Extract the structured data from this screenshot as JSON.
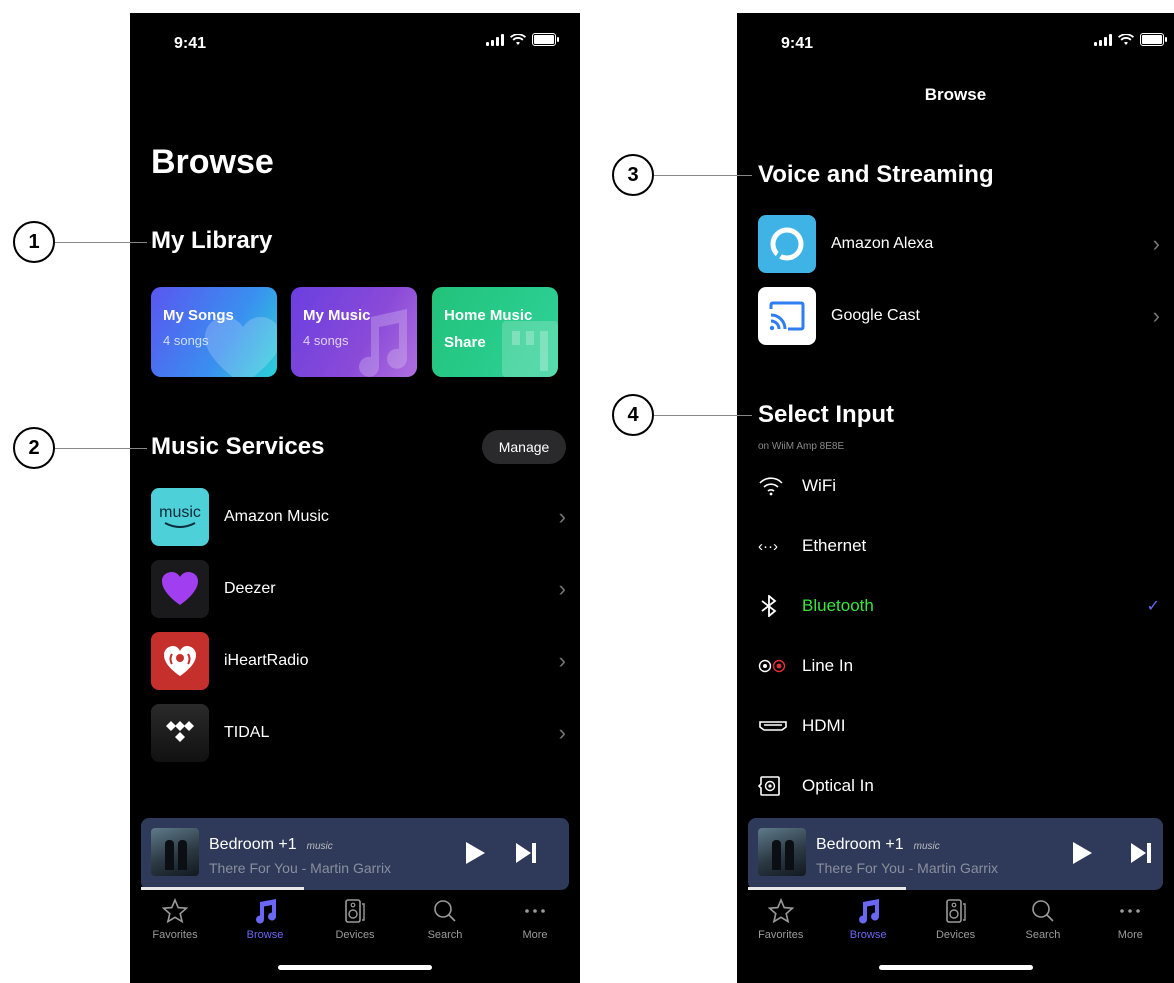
{
  "status": {
    "time": "9:41"
  },
  "left": {
    "page_title": "Browse",
    "my_library": {
      "title": "My Library",
      "tiles": [
        {
          "name": "My Songs",
          "sub": "4 songs"
        },
        {
          "name": "My Music",
          "sub": "4 songs"
        },
        {
          "name": "Home Music",
          "sub": "Share"
        }
      ]
    },
    "music_services": {
      "title": "Music Services",
      "manage_label": "Manage",
      "items": [
        {
          "label": "Amazon Music",
          "logo": "amazon-music-logo",
          "logo_text": "music"
        },
        {
          "label": "Deezer",
          "logo": "deezer-heart-logo"
        },
        {
          "label": "iHeartRadio",
          "logo": "iheartradio-logo"
        },
        {
          "label": "TIDAL",
          "logo": "tidal-logo"
        }
      ]
    }
  },
  "right": {
    "header_title": "Browse",
    "voice_streaming": {
      "title": "Voice and Streaming",
      "items": [
        {
          "label": "Amazon Alexa",
          "logo": "alexa-logo"
        },
        {
          "label": "Google Cast",
          "logo": "google-cast-logo"
        }
      ]
    },
    "select_input": {
      "title": "Select Input",
      "subtitle": "on WiiM Amp 8E8E",
      "items": [
        {
          "label": "WiFi",
          "icon": "wifi-icon",
          "selected": false
        },
        {
          "label": "Ethernet",
          "icon": "ethernet-icon",
          "selected": false,
          "icon_text": "‹··›"
        },
        {
          "label": "Bluetooth",
          "icon": "bluetooth-icon",
          "selected": true
        },
        {
          "label": "Line In",
          "icon": "line-in-icon",
          "selected": false
        },
        {
          "label": "HDMI",
          "icon": "hdmi-icon",
          "selected": false
        },
        {
          "label": "Optical In",
          "icon": "optical-icon",
          "selected": false
        }
      ]
    }
  },
  "now_playing": {
    "device": "Bedroom +1",
    "source_badge": "music",
    "track": "There For You - Martin Garrix",
    "progress_fraction": 0.38
  },
  "tabs": [
    {
      "label": "Favorites",
      "icon": "star-icon",
      "active": false
    },
    {
      "label": "Browse",
      "icon": "music-note-icon",
      "active": true
    },
    {
      "label": "Devices",
      "icon": "speaker-icon",
      "active": false
    },
    {
      "label": "Search",
      "icon": "search-icon",
      "active": false
    },
    {
      "label": "More",
      "icon": "more-icon",
      "active": false
    }
  ],
  "callouts": [
    "1",
    "2",
    "3",
    "4"
  ],
  "colors": {
    "accent": "#6b67f5",
    "selected_input": "#39e63a",
    "mini_player": "#2f3a5a"
  }
}
